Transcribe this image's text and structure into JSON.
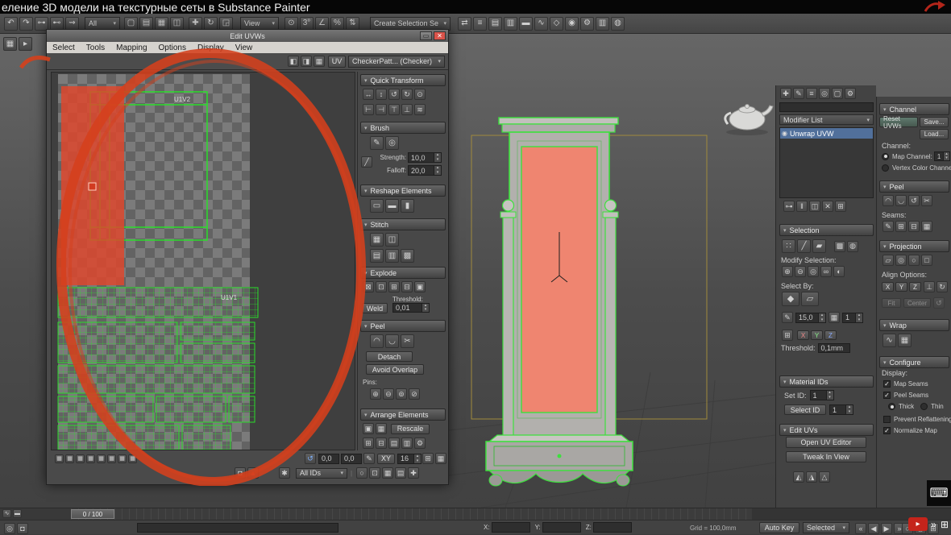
{
  "title_bar": {
    "title": "еление 3D модели на текстурные сеты в Substance Painter"
  },
  "toolbar": {
    "selection_filter": "All",
    "ref_coord": "View",
    "named_selection": "Create Selection Se"
  },
  "uv_window": {
    "title": "Edit UVWs",
    "menus": [
      "Select",
      "Tools",
      "Mapping",
      "Options",
      "Display",
      "View"
    ],
    "uv_button": "UV",
    "checker_dropdown": "CheckerPatt... (Checker)",
    "tiles": {
      "top": "U1V2",
      "bottom": "U1V1"
    },
    "rollouts": {
      "quick_transform": "Quick Transform",
      "brush": "Brush",
      "strength_label": "Strength:",
      "strength_value": "10,0",
      "falloff_label": "Falloff:",
      "falloff_value": "20,0",
      "reshape": "Reshape Elements",
      "stitch": "Stitch",
      "explode": "Explode",
      "weld_button": "Weld",
      "threshold_label": "Threshold:",
      "threshold_value": "0,01",
      "peel": "Peel",
      "detach_button": "Detach",
      "avoid_overlap_button": "Avoid Overlap",
      "pins_label": "Pins:",
      "arrange": "Arrange Elements",
      "rescale_button": "Rescale"
    },
    "status": {
      "u": "0,0",
      "v": "0,0",
      "xy_button": "XY",
      "grid": "16",
      "id_filter": "All IDs"
    }
  },
  "panel_mid": {
    "modifier_list": "Modifier List",
    "modifier": "Unwrap UVW",
    "selection": {
      "header": "Selection",
      "modify_selection": "Modify Selection:",
      "select_by": "Select By:",
      "planar_angle": "15,0",
      "matid_value": "1",
      "x": "X",
      "y": "Y",
      "z": "Z",
      "threshold_label": "Threshold:",
      "threshold_value": "0,1mm"
    },
    "material_ids": {
      "header": "Material IDs",
      "set_id_label": "Set ID:",
      "set_id_value": "1",
      "select_id_button": "Select ID",
      "select_id_value": "1"
    },
    "edit_uvs": {
      "header": "Edit UVs",
      "open_uv_editor": "Open UV Editor",
      "tweak_in_view": "Tweak In View"
    }
  },
  "panel_right": {
    "channel": {
      "header": "Channel",
      "reset": "Reset UVWs",
      "save": "Save...",
      "load": "Load...",
      "channel_label": "Channel:",
      "map_channel": "Map Channel:",
      "map_channel_value": "1",
      "vertex_color": "Vertex Color Channel"
    },
    "peel": {
      "header": "Peel",
      "seams_label": "Seams:"
    },
    "projection": {
      "header": "Projection",
      "align_options": "Align Options:",
      "x": "X",
      "y": "Y",
      "z": "Z",
      "fit": "Fit",
      "center": "Center"
    },
    "wrap": {
      "header": "Wrap"
    },
    "configure": {
      "header": "Configure",
      "display_label": "Display:",
      "map_seams": "Map Seams",
      "peel_seams": "Peel Seams",
      "thick": "Thick",
      "thin": "Thin",
      "prevent_reflattening": "Prevent Reflattening",
      "normalize_map": "Normalize Map"
    }
  },
  "bottom": {
    "timeline_value": "0 / 100",
    "x_label": "X:",
    "y_label": "Y:",
    "z_label": "Z:",
    "grid_label": "Grid = 100,0mm",
    "auto_key": "Auto Key",
    "selected": "Selected"
  },
  "colors": {
    "uv_green": "#3de03d",
    "selection_red": "#da452a",
    "face_salmon": "#ef8570",
    "annotation_red": "#d5401c"
  },
  "glyphs": {
    "rotate_type_in": "↺",
    "pen": "✎",
    "lock": "◘",
    "red_pin": "▲",
    "freeze": "✱",
    "eye": "◉",
    "kbd": "⌨",
    "player_play": "▸",
    "player_next": "»",
    "player_grid": "⊞",
    "matid_grid": "▦",
    "smgrp": "⊞",
    "falloff_curve": "╱",
    "close": "✕",
    "restore": "▭",
    "sep": "|"
  },
  "strips": {
    "tb_a": [
      {
        "n": "undo-icon",
        "g": "↶"
      },
      {
        "n": "redo-icon",
        "g": "↷"
      },
      {
        "n": "select-and-link-icon",
        "g": "⊶"
      },
      {
        "n": "unlink-selection-icon",
        "g": "⊷"
      },
      {
        "n": "bind-to-space-warp-icon",
        "g": "⇝"
      }
    ],
    "tb_b": [
      {
        "n": "select-object-icon",
        "g": "▢"
      },
      {
        "n": "select-by-name-icon",
        "g": "▤"
      },
      {
        "n": "selection-region-icon",
        "g": "▦"
      },
      {
        "n": "window-crossing-icon",
        "g": "◫"
      }
    ],
    "tb_c": [
      {
        "n": "select-and-move-icon",
        "g": "✚"
      },
      {
        "n": "select-and-rotate-icon",
        "g": "↻"
      },
      {
        "n": "select-and-scale-icon",
        "g": "◲"
      }
    ],
    "tb_d": [
      {
        "n": "use-pivot-center-icon",
        "g": "⊙"
      },
      {
        "n": "snap-toggle-icon",
        "g": "3°"
      },
      {
        "n": "angle-snap-icon",
        "g": "∠"
      },
      {
        "n": "percent-snap-icon",
        "g": "%"
      },
      {
        "n": "spinner-snap-icon",
        "g": "⇅"
      }
    ],
    "tb_e": [
      {
        "n": "mirror-icon",
        "g": "⇄"
      },
      {
        "n": "align-icon",
        "g": "≡"
      },
      {
        "n": "scene-explorer-icon",
        "g": "▤"
      },
      {
        "n": "layer-manager-icon",
        "g": "▥"
      },
      {
        "n": "ribbon-toggle-icon",
        "g": "▬"
      },
      {
        "n": "curve-editor-icon",
        "g": "∿"
      },
      {
        "n": "schematic-view-icon",
        "g": "◇"
      },
      {
        "n": "material-editor-icon",
        "g": "◉"
      },
      {
        "n": "render-setup-icon",
        "g": "⚙"
      },
      {
        "n": "rendered-frame-icon",
        "g": "▥"
      },
      {
        "n": "render-production-icon",
        "g": "◍"
      }
    ],
    "left_mini": [
      {
        "n": "workspace-toggle-icon",
        "g": "▦"
      },
      {
        "n": "toolbar-overflow-icon",
        "g": "▸"
      }
    ],
    "cmd_tabs": [
      {
        "n": "create-tab-icon",
        "g": "✚"
      },
      {
        "n": "modify-tab-icon",
        "g": "✎"
      },
      {
        "n": "hierarchy-tab-icon",
        "g": "≡"
      },
      {
        "n": "motion-tab-icon",
        "g": "◎"
      },
      {
        "n": "display-tab-icon",
        "g": "▢"
      },
      {
        "n": "utilities-tab-icon",
        "g": "⚙"
      }
    ],
    "stack_buttons": [
      {
        "n": "pin-stack-icon",
        "g": "⊶"
      },
      {
        "n": "show-end-result-icon",
        "g": "‖"
      },
      {
        "n": "make-unique-icon",
        "g": "◫"
      },
      {
        "n": "remove-modifier-icon",
        "g": "✕"
      },
      {
        "n": "configure-modifier-sets-icon",
        "g": "⊞"
      }
    ],
    "sel_sub_icons": [
      {
        "n": "vertex-sub-icon",
        "g": "∷"
      },
      {
        "n": "edge-sub-icon",
        "g": "╱"
      },
      {
        "n": "polygon-sub-icon",
        "g": "▰"
      }
    ],
    "sel_sub_extra": [
      {
        "n": "select-element-icon",
        "g": "▩"
      },
      {
        "n": "ignore-backfacing-icon",
        "g": "◍"
      }
    ],
    "modify_sel_icons": [
      {
        "n": "grow-selection-icon",
        "g": "⊕"
      },
      {
        "n": "shrink-selection-icon",
        "g": "⊖"
      },
      {
        "n": "ring-selection-icon",
        "g": "◎"
      },
      {
        "n": "loop-selection-icon",
        "g": "∞"
      },
      {
        "n": "half-selection-icon",
        "g": "◐"
      }
    ],
    "select_by_icons": [
      {
        "n": "select-by-element-icon",
        "g": "◆"
      },
      {
        "n": "planar-angle-icon",
        "g": "▱"
      }
    ],
    "tri_icons": [
      {
        "n": "align-to-view-icon",
        "g": "◭"
      },
      {
        "n": "align-to-edge-icon",
        "g": "◮"
      },
      {
        "n": "align-to-pelt-icon",
        "g": "△"
      }
    ],
    "peel_icons_r": [
      {
        "n": "quick-peel-icon",
        "g": "◠"
      },
      {
        "n": "peel-mode-icon",
        "g": "◡"
      },
      {
        "n": "reset-peel-icon",
        "g": "↺"
      },
      {
        "n": "edit-seams-icon",
        "g": "✂"
      }
    ],
    "seams_icons": [
      {
        "n": "point-to-point-seam-icon",
        "g": "✎"
      },
      {
        "n": "edge-to-seam-icon",
        "g": "⊞"
      },
      {
        "n": "expand-to-seam-icon",
        "g": "⊟"
      },
      {
        "n": "convert-seam-icon",
        "g": "▦"
      }
    ],
    "proj_icons": [
      {
        "n": "planar-map-icon",
        "g": "▱"
      },
      {
        "n": "cylindrical-map-icon",
        "g": "◎"
      },
      {
        "n": "spherical-map-icon",
        "g": "○"
      },
      {
        "n": "box-map-icon",
        "g": "□"
      }
    ],
    "proj_extra_icons": [
      {
        "n": "align-normal-icon",
        "g": "⊥"
      },
      {
        "n": "align-view-icon",
        "g": "↻"
      }
    ],
    "wrap_icons": [
      {
        "n": "spline-wrap-icon",
        "g": "∿"
      },
      {
        "n": "surface-wrap-icon",
        "g": "▦"
      }
    ],
    "uv_checker_icons": [
      {
        "n": "show-checker-a-icon",
        "g": "◧"
      },
      {
        "n": "show-checker-b-icon",
        "g": "◨"
      },
      {
        "n": "show-map-icon",
        "g": "▦"
      }
    ],
    "qt_row1": [
      {
        "n": "move-horizontal-icon",
        "g": "↔"
      },
      {
        "n": "move-vertical-icon",
        "g": "↕"
      },
      {
        "n": "rotate-ccw-icon",
        "g": "↺"
      },
      {
        "n": "rotate-cw-icon",
        "g": "↻"
      },
      {
        "n": "snap-center-icon",
        "g": "⊙"
      }
    ],
    "qt_row2": [
      {
        "n": "align-left-icon",
        "g": "⊢"
      },
      {
        "n": "align-right-icon",
        "g": "⊣"
      },
      {
        "n": "align-top-icon",
        "g": "⊤"
      },
      {
        "n": "align-bottom-icon",
        "g": "⊥"
      },
      {
        "n": "space-evenly-icon",
        "g": "≋"
      }
    ],
    "brush_icons": [
      {
        "n": "paint-move-brush-icon",
        "g": "✎"
      },
      {
        "n": "relax-brush-icon",
        "g": "◎"
      }
    ],
    "reshape_icons": [
      {
        "n": "straighten-selection-icon",
        "g": "▭"
      },
      {
        "n": "align-horizontal-icon",
        "g": "▬"
      },
      {
        "n": "align-vertical-icon",
        "g": "▮"
      }
    ],
    "stitch_row1": [
      {
        "n": "stitch-custom-icon",
        "g": "▦"
      },
      {
        "n": "stitch-average-icon",
        "g": "◫"
      }
    ],
    "stitch_row2": [
      {
        "n": "stitch-source-icon",
        "g": "▤"
      },
      {
        "n": "stitch-target-icon",
        "g": "▥"
      },
      {
        "n": "stitch-all-icon",
        "g": "▩"
      }
    ],
    "explode_icons": [
      {
        "n": "break-icon",
        "g": "⊠"
      },
      {
        "n": "detach-edge-verts-icon",
        "g": "⊡"
      },
      {
        "n": "flatten-by-smoothing-icon",
        "g": "⊞"
      },
      {
        "n": "flatten-by-material-icon",
        "g": "⊟"
      },
      {
        "n": "flatten-mapping-icon",
        "g": "▣"
      }
    ],
    "peel_icons": [
      {
        "n": "quick-peel-icon",
        "g": "◠"
      },
      {
        "n": "peel-mode-icon",
        "g": "◡"
      },
      {
        "n": "edit-seams-icon",
        "g": "✂"
      }
    ],
    "pins_icons": [
      {
        "n": "pin-selected-icon",
        "g": "⊕"
      },
      {
        "n": "unpin-selected-icon",
        "g": "⊖"
      },
      {
        "n": "pin-moved-icon",
        "g": "⊚"
      },
      {
        "n": "unpin-all-icon",
        "g": "⊘"
      }
    ],
    "arrange_icons1": [
      {
        "n": "pack-normalize-icon",
        "g": "▣"
      },
      {
        "n": "pack-padding-icon",
        "g": "▦"
      }
    ],
    "arrange_icons2": [
      {
        "n": "pack-full-icon",
        "g": "⊞"
      },
      {
        "n": "pack-tight-icon",
        "g": "⊟"
      },
      {
        "n": "group-elements-icon",
        "g": "▤"
      },
      {
        "n": "ungroup-elements-icon",
        "g": "▥"
      },
      {
        "n": "pack-settings-icon",
        "g": "⚙"
      }
    ],
    "uv_thumbs": [
      {
        "n": "texture-thumb-icon",
        "g": "▦"
      },
      {
        "n": "texture-thumb-icon",
        "g": "▦"
      },
      {
        "n": "texture-thumb-icon",
        "g": "▦"
      },
      {
        "n": "texture-thumb-icon",
        "g": "▦"
      },
      {
        "n": "texture-thumb-icon",
        "g": "▦"
      },
      {
        "n": "texture-thumb-icon",
        "g": "▦"
      },
      {
        "n": "texture-thumb-icon",
        "g": "▦"
      },
      {
        "n": "texture-thumb-icon",
        "g": "▦"
      }
    ],
    "uv_status_icons2": [
      {
        "n": "zoom-icon",
        "g": "○"
      },
      {
        "n": "zoom-region-icon",
        "g": "⊡"
      },
      {
        "n": "zoom-extents-icon",
        "g": "▦"
      },
      {
        "n": "zoom-selected-icon",
        "g": "▤"
      },
      {
        "n": "pan-icon",
        "g": "✚"
      }
    ],
    "playback_icons": [
      {
        "n": "go-to-start-icon",
        "g": "«"
      },
      {
        "n": "previous-frame-icon",
        "g": "◀"
      },
      {
        "n": "play-animation-icon",
        "g": "▶"
      },
      {
        "n": "next-frame-icon",
        "g": "»"
      }
    ],
    "vp_nav_icons": [
      {
        "n": "zoom-viewport-icon",
        "g": "○"
      },
      {
        "n": "zoom-all-icon",
        "g": "◎"
      },
      {
        "n": "maximize-viewport-icon",
        "g": "⊞"
      }
    ],
    "trackbar_icons": [
      {
        "n": "mini-curve-editor-icon",
        "g": "∿"
      },
      {
        "n": "selection-range-icon",
        "g": "▬"
      }
    ],
    "status_left_icons": [
      {
        "n": "isolate-selection-icon",
        "g": "◎"
      },
      {
        "n": "selection-lock-icon",
        "g": "◘"
      }
    ]
  }
}
